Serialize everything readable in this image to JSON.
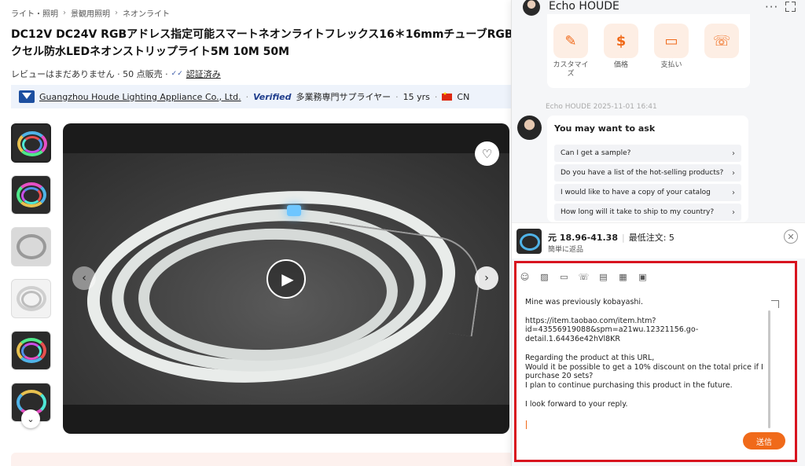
{
  "breadcrumb": [
    "ライト・照明",
    "景観用照明",
    "ネオンライト"
  ],
  "product": {
    "title_line1": "DC12V DC24V RGBアドレス指定可能スマートネオンライトフレックス16＊16mmチューブRGBピ",
    "title_line2": "クセル防水LEDネオンストリップライト5M 10M 50M",
    "review_text": "レビューはまだありません · 50 点販売 ·",
    "verified_mark": "✓✓",
    "verified_label": "認証済み"
  },
  "supplier": {
    "name": "Guangzhou Houde Lighting Appliance Co., Ltd.",
    "verified": "Verified",
    "type": "多業務専門サプライヤー",
    "years": "15 yrs",
    "country": "CN"
  },
  "chat": {
    "contact_name": "Echo HOUDE",
    "quick_actions": [
      {
        "label": "カスタマイズ",
        "icon": "wrench-icon",
        "glyph": "✎"
      },
      {
        "label": "価格",
        "icon": "dollar-icon",
        "glyph": "$"
      },
      {
        "label": "支払い",
        "icon": "card-icon",
        "glyph": "▭"
      },
      {
        "label": "",
        "icon": "headset-icon",
        "glyph": "☏"
      }
    ],
    "message_time": "Echo HOUDE  2025-11-01 16:41",
    "ask_title": "You may want to ask",
    "ask_items": [
      "Can I get a sample?",
      "Do you have a list of the hot-selling products?",
      "I would like to have a copy of your catalog",
      "How long will it take to ship to my country?"
    ],
    "product_price": "元 18.96-41.38",
    "product_moq": "最低注文: 5",
    "product_easy": "簡単に返品",
    "draft": "Mine was previously kobayashi.\n\nhttps://item.taobao.com/item.htm?\nid=43556919088&spm=a21wu.12321156.go-\ndetail.1.64436e42hVl8KR\n\nRegarding the product at this URL,\nWould it be possible to get a 10% discount on the total price if I\npurchase 20 sets?\nI plan to continue purchasing this product in the future.\n\nI look forward to your reply.",
    "send_label": "送信"
  },
  "colors": {
    "accent": "#f06a1a",
    "highlight_border": "#d8141f",
    "supplier_band": "#eef3fb"
  }
}
